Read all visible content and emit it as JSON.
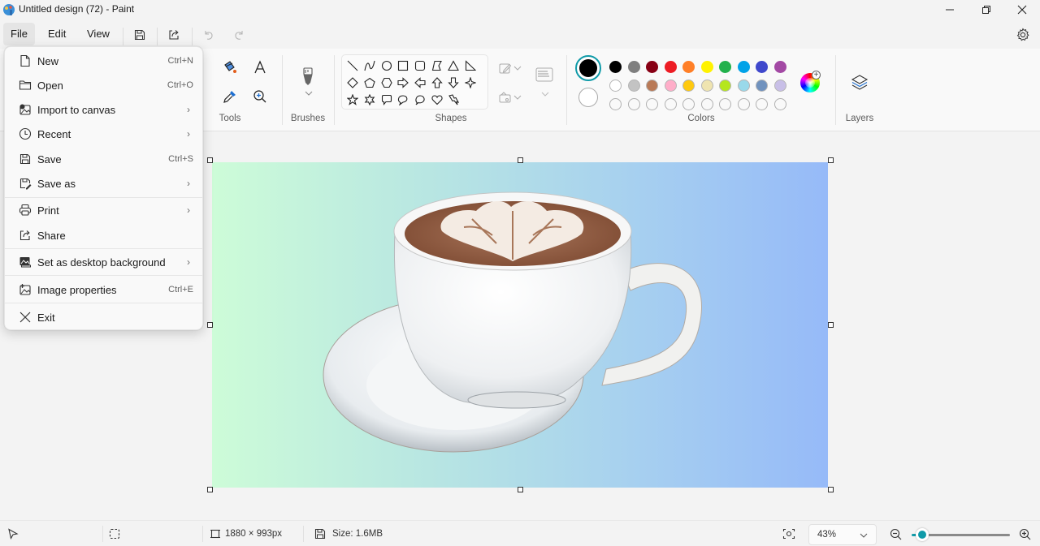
{
  "window": {
    "title": "Untitled design (72) - Paint",
    "controls": [
      "minimize",
      "restore",
      "close"
    ]
  },
  "menubar": {
    "items": [
      {
        "label": "File",
        "active": true
      },
      {
        "label": "Edit"
      },
      {
        "label": "View"
      }
    ],
    "quick_actions": [
      "save-icon",
      "share-icon",
      "undo-icon",
      "redo-icon"
    ]
  },
  "ribbon": {
    "groups": {
      "tools": {
        "label": "Tools",
        "items": [
          "fill-icon",
          "text-icon",
          "color-picker-icon",
          "magnifier-icon"
        ]
      },
      "brushes": {
        "label": "Brushes"
      },
      "shapes": {
        "label": "Shapes",
        "items": [
          "line",
          "curve",
          "oval",
          "rectangle",
          "rounded-rectangle",
          "polygon",
          "triangle",
          "right-triangle",
          "diamond",
          "pentagon",
          "hexagon",
          "right-arrow",
          "left-arrow",
          "up-arrow",
          "down-arrow",
          "four-point-star",
          "five-point-star",
          "six-point-star",
          "rounded-callout",
          "oval-callout",
          "cloud-callout",
          "heart",
          "lightning"
        ]
      },
      "colors": {
        "label": "Colors",
        "primary": "#000000",
        "secondary": "#ffffff",
        "palette_row1": [
          "#000000",
          "#7f7f7f",
          "#880015",
          "#ed1c24",
          "#ff7f27",
          "#fff200",
          "#22b14c",
          "#00a2e8",
          "#3f48cc",
          "#a349a4"
        ],
        "palette_row2": [
          "#ffffff",
          "#c3c3c3",
          "#b97a57",
          "#ffaec9",
          "#ffc90e",
          "#efe4b0",
          "#b5e61d",
          "#99d9ea",
          "#7092be",
          "#c8bfe7"
        ],
        "custom_slots": 10
      },
      "layers": {
        "label": "Layers"
      }
    }
  },
  "file_menu": {
    "items": [
      {
        "label": "New",
        "shortcut": "Ctrl+N",
        "icon": "new-file-icon"
      },
      {
        "label": "Open",
        "shortcut": "Ctrl+O",
        "icon": "folder-icon"
      },
      {
        "label": "Import to canvas",
        "submenu": true,
        "icon": "import-image-icon"
      },
      {
        "label": "Recent",
        "submenu": true,
        "icon": "clock-icon"
      },
      {
        "label": "Save",
        "shortcut": "Ctrl+S",
        "icon": "save-icon"
      },
      {
        "label": "Save as",
        "submenu": true,
        "icon": "save-as-icon"
      },
      {
        "label": "Print",
        "submenu": true,
        "icon": "printer-icon"
      },
      {
        "label": "Share",
        "icon": "share-icon"
      },
      {
        "label": "Set as desktop background",
        "submenu": true,
        "icon": "desktop-background-icon"
      },
      {
        "label": "Image properties",
        "shortcut": "Ctrl+E",
        "icon": "image-properties-icon"
      },
      {
        "label": "Exit",
        "icon": "close-icon"
      }
    ],
    "chevron": "›"
  },
  "canvas": {
    "image_description": "Latte coffee cup with saucer on green-to-blue gradient"
  },
  "statusbar": {
    "dimensions": "1880 × 993px",
    "size": "Size: 1.6MB",
    "zoom": "43%",
    "zoom_level_fraction": 0.1
  }
}
